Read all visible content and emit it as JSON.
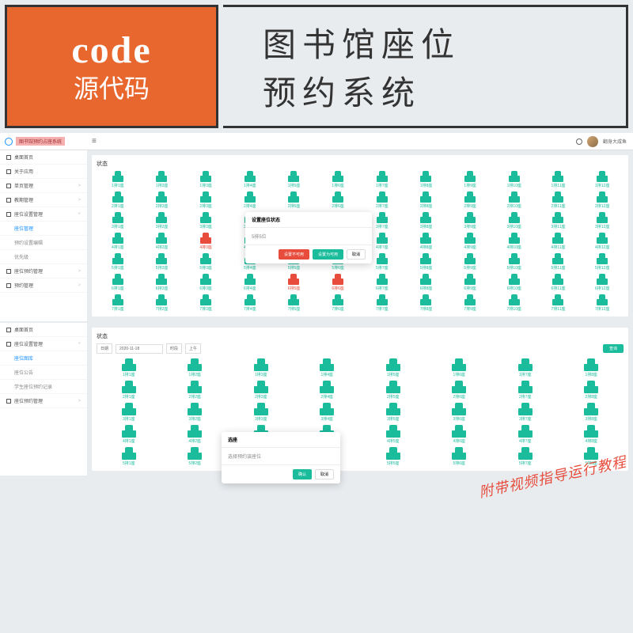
{
  "hero": {
    "logo_top": "code",
    "logo_bottom": "源代码",
    "title_1": "图书馆座位",
    "title_2": "预约系统"
  },
  "topbar": {
    "system_title": "图书馆预约占座系统",
    "username": "翻身大咸鱼"
  },
  "sidebar1": {
    "items": [
      {
        "label": "桌面首页",
        "icon": "home"
      },
      {
        "label": "关于应用",
        "icon": "info"
      },
      {
        "label": "单页管理",
        "icon": "page",
        "arrow": true
      },
      {
        "label": "教期管理",
        "icon": "calendar",
        "arrow": true
      },
      {
        "label": "座位设置管理",
        "icon": "seat",
        "arrow": true,
        "expanded": true
      },
      {
        "label": "座位管理",
        "sub": true,
        "active": true
      },
      {
        "label": "预约设置编辑",
        "sub": true
      },
      {
        "label": "优先级",
        "sub": true
      },
      {
        "label": "座位预约管理",
        "icon": "book",
        "arrow": true
      },
      {
        "label": "预约管理",
        "icon": "list",
        "arrow": true
      }
    ]
  },
  "sidebar2": {
    "items": [
      {
        "label": "桌面首页",
        "icon": "home"
      },
      {
        "label": "座位设置管理",
        "icon": "seat",
        "arrow": true,
        "expanded": true
      },
      {
        "label": "座位图库",
        "sub": true,
        "active": true
      },
      {
        "label": "座位公告",
        "sub": true
      },
      {
        "label": "学生座位预约记录",
        "sub": true
      },
      {
        "label": "座位预约管理",
        "icon": "book",
        "arrow": true
      }
    ]
  },
  "card1": {
    "title": "状态",
    "rows": 7,
    "cols": 12,
    "red_seats": [
      "4-3",
      "6-5",
      "6-6"
    ]
  },
  "modal1": {
    "title": "设置座位状态",
    "body": "5排5位",
    "btn_red": "设置不可用",
    "btn_teal": "设置为可用",
    "btn_cancel": "取消"
  },
  "card2": {
    "title": "状态",
    "filter": {
      "date_label": "日期",
      "date_value": "2020-11-18",
      "time_label": "时段",
      "time_value": "上午",
      "query": "查询"
    },
    "rows": 5,
    "cols": 8
  },
  "modal2": {
    "title": "选座",
    "body": "选择预约该座位",
    "btn_confirm": "确认",
    "btn_cancel": "取消"
  },
  "footer": "附带视频指导运行教程"
}
